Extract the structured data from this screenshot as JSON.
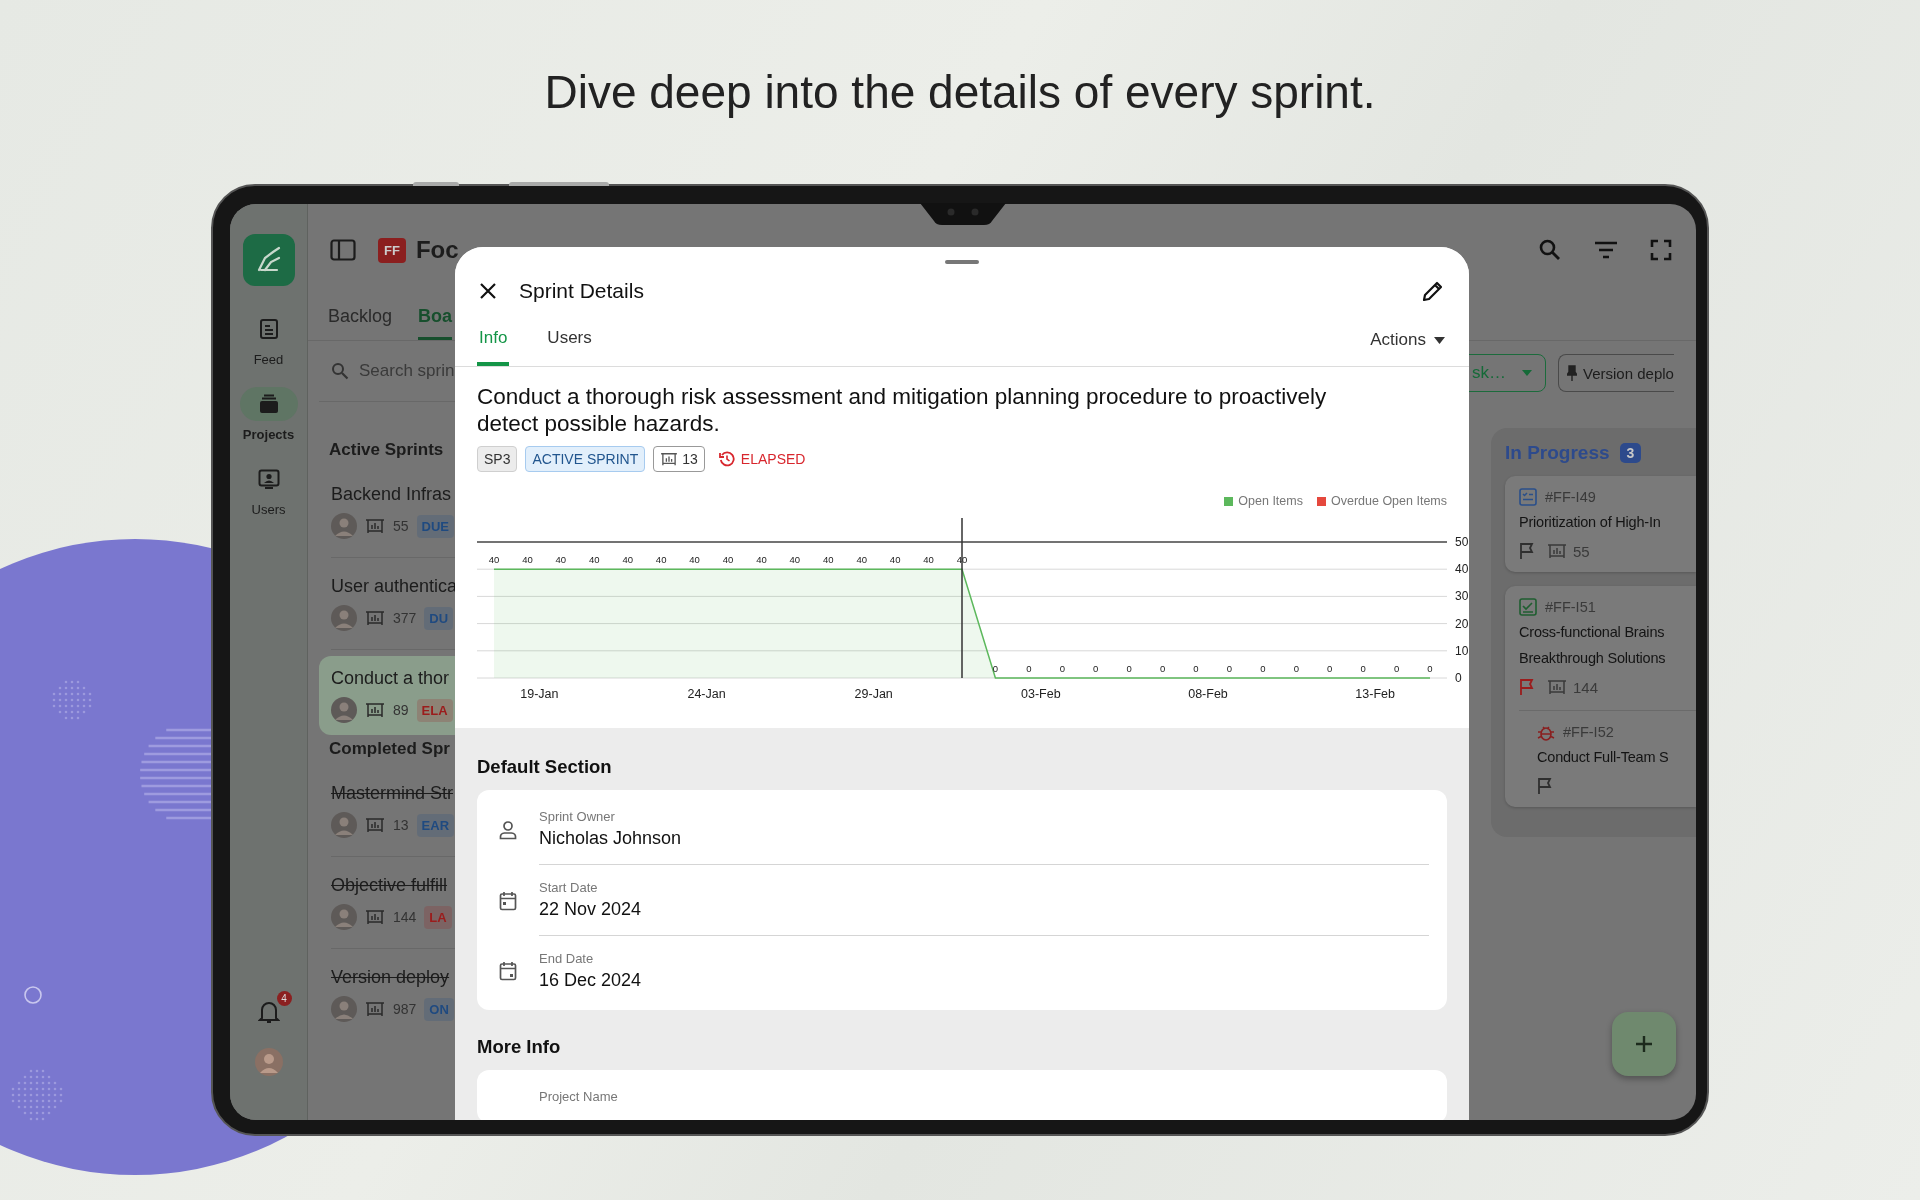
{
  "headline": "Dive deep into the details of every sprint.",
  "app": {
    "rail": {
      "items": [
        {
          "kind": "feed",
          "label": "Feed",
          "selected": false
        },
        {
          "kind": "projects",
          "label": "Projects",
          "selected": true
        },
        {
          "kind": "users",
          "label": "Users",
          "selected": false
        }
      ],
      "notifications": "4"
    },
    "header": {
      "project_badge": "FF",
      "project_title": "Foc"
    },
    "tabs": [
      {
        "label": "Backlog",
        "selected": false
      },
      {
        "label": "Boa",
        "selected": true
      }
    ],
    "sprint_list": {
      "search": {
        "placeholder": "Search sprin"
      },
      "sections": [
        {
          "title": "Active Sprints",
          "sprints": [
            {
              "name": "Backend Infras",
              "count": "55",
              "badge": "DUE",
              "color": "#1f4a80",
              "completed": false,
              "selected": false
            },
            {
              "name": "User authentica",
              "count": "377",
              "badge": "DU",
              "color": "#1f4a80",
              "completed": false,
              "selected": false
            },
            {
              "name": "Conduct a thor",
              "count": "89",
              "badge": "ELA",
              "color": "#9b1c1c",
              "completed": false,
              "selected": true
            }
          ]
        },
        {
          "title": "Completed Spr",
          "sprints": [
            {
              "name": "Mastermind Str",
              "count": "13",
              "badge": "EAR",
              "color": "#1f4a80",
              "completed": true,
              "selected": false
            },
            {
              "name": "Objective fulfill",
              "count": "144",
              "badge": "LA",
              "color": "#9b1c1c",
              "completed": true,
              "selected": false
            },
            {
              "name": "Version deploy",
              "count": "987",
              "badge": "ON",
              "color": "#1f4a80",
              "completed": true,
              "selected": false
            }
          ]
        }
      ]
    },
    "filters": [
      {
        "kind": "dropdown",
        "label": "sk…"
      },
      {
        "kind": "pinned",
        "label": "Version deplo"
      }
    ],
    "board_column": {
      "title": "In Progress",
      "count": "3",
      "cards": [
        {
          "kind": "checklist",
          "id": "#FF-I49",
          "title_lines": [
            "Prioritization of High-In"
          ],
          "flagged": false,
          "count": "55"
        },
        {
          "kind": "checked",
          "id": "#FF-I51",
          "title_lines": [
            "Cross-functional Brains",
            "Breakthrough Solutions"
          ],
          "flagged": true,
          "count": "144",
          "children": [
            {
              "kind": "bug",
              "id": "#FF-I52",
              "title_lines": [
                "Conduct Full-Team S"
              ],
              "flagged": false
            }
          ]
        }
      ]
    }
  },
  "sprint_details": {
    "title": "Sprint Details",
    "tabs": [
      {
        "label": "Info",
        "selected": true
      },
      {
        "label": "Users",
        "selected": false
      }
    ],
    "actions": "Actions",
    "sprint_title": "Conduct a thorough risk assessment and mitigation planning procedure to proactively detect possible hazards.",
    "chips": [
      {
        "kind": "code",
        "label": "SP3"
      },
      {
        "kind": "status",
        "label": "ACTIVE SPRINT"
      },
      {
        "kind": "count",
        "label": "13"
      },
      {
        "kind": "alert",
        "label": "ELAPSED"
      }
    ],
    "chart_data": {
      "type": "area",
      "categories": [
        null,
        "19-Jan",
        null,
        null,
        null,
        null,
        "24-Jan",
        null,
        null,
        null,
        null,
        "29-Jan",
        null,
        null,
        null,
        null,
        "03-Feb",
        null,
        null,
        null,
        null,
        "08-Feb",
        null,
        null,
        null,
        null,
        "13-Feb",
        null,
        null
      ],
      "ylim": [
        0,
        50
      ],
      "yticks": [
        0,
        10,
        20,
        30,
        40,
        50
      ],
      "series": [
        {
          "name": "Open Items",
          "color": "#5cb85c",
          "values": [
            40,
            40,
            40,
            40,
            40,
            40,
            40,
            40,
            40,
            40,
            40,
            40,
            40,
            40,
            40,
            0,
            0,
            0,
            0,
            0,
            0,
            0,
            0,
            0,
            0,
            0,
            0,
            0,
            0
          ]
        },
        {
          "name": "Overdue Open Items",
          "color": "#e5483d",
          "values": [
            null,
            null,
            null,
            null,
            null,
            null,
            null,
            null,
            null,
            null,
            null,
            null,
            null,
            null,
            null,
            null,
            null,
            null,
            null,
            null,
            null,
            null,
            null,
            null,
            null,
            null,
            null,
            null,
            null
          ]
        }
      ],
      "data_labels": true,
      "grid": true
    },
    "sections": [
      {
        "title": "Default Section",
        "fields": [
          {
            "kind": "person",
            "label": "Sprint Owner",
            "value": "Nicholas Johnson"
          },
          {
            "kind": "start-date",
            "label": "Start Date",
            "value": "22 Nov 2024"
          },
          {
            "kind": "end-date",
            "label": "End Date",
            "value": "16 Dec 2024"
          }
        ]
      },
      {
        "title": "More Info",
        "fields": [
          {
            "kind": "text",
            "label": "Project Name"
          }
        ]
      }
    ]
  }
}
